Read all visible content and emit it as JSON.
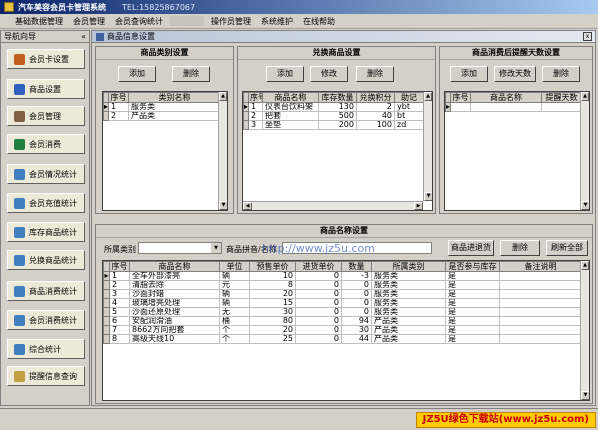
{
  "window": {
    "title": "汽车美容会员卡管理系统",
    "tel": "TEL:15825867067"
  },
  "menu": [
    "基础数据管理",
    "会员管理",
    "会员查询统计",
    "",
    "操作员管理",
    "系统维护",
    "在线帮助"
  ],
  "nav": {
    "title": "导航向导",
    "collapse": "«",
    "items": [
      "会员卡设置",
      "商品设置",
      "会员管理",
      "会员消费",
      "会员情况统计",
      "会员充值统计",
      "库存商品统计",
      "兑换商品统计",
      "商品消费统计",
      "会员消费统计",
      "综合统计",
      "提醒信息查询"
    ]
  },
  "main": {
    "title": "商品信息设置",
    "close": "x"
  },
  "category_panel": {
    "title": "商品类别设置",
    "buttons": {
      "add": "添加",
      "delete": "删除"
    },
    "columns": [
      "序号",
      "类别名称"
    ],
    "rows": [
      [
        "1",
        "服务类"
      ],
      [
        "2",
        "产品类"
      ]
    ]
  },
  "exchange_panel": {
    "title": "兑换商品设置",
    "buttons": {
      "add": "添加",
      "edit": "修改",
      "delete": "删除"
    },
    "columns": [
      "序号",
      "商品名称",
      "库存数量",
      "兑换积分",
      "助记"
    ],
    "rows": [
      [
        "1",
        "仪表台饮料架",
        "130",
        "2",
        "ybt"
      ],
      [
        "2",
        "把套",
        "500",
        "40",
        "bt"
      ],
      [
        "3",
        "坐垫",
        "200",
        "100",
        "zd"
      ]
    ]
  },
  "reminder_panel": {
    "title": "商品消费后提醒天数设置",
    "buttons": {
      "add": "添加",
      "edit": "修改天数",
      "delete": "删除"
    },
    "columns": [
      "序号",
      "商品名称",
      "提醒天数"
    ]
  },
  "product_panel": {
    "title": "商品名称设置",
    "filter_label": "所属类别",
    "name_label": "商品拼音/名称",
    "buttons": {
      "stock": "商品进退货",
      "delete": "删除",
      "refresh": "刷新全部"
    },
    "columns": [
      "序号",
      "商品名称",
      "单位",
      "预售单价",
      "进货单价",
      "数量",
      "所属类别",
      "是否参与库存",
      "备注说明"
    ],
    "rows": [
      [
        "1",
        "全车外部漆亮",
        "辆",
        "10",
        "0",
        "-3",
        "服务类",
        "是",
        ""
      ],
      [
        "2",
        "清脂去除",
        "元",
        "8",
        "0",
        "0",
        "服务类",
        "是",
        ""
      ],
      [
        "3",
        "沙面封蜡",
        "辆",
        "20",
        "0",
        "0",
        "服务类",
        "是",
        ""
      ],
      [
        "4",
        "玻璃增亮处理",
        "辆",
        "15",
        "0",
        "0",
        "服务类",
        "是",
        ""
      ],
      [
        "5",
        "沙面还原处理",
        "无",
        "30",
        "0",
        "0",
        "服务类",
        "是",
        ""
      ],
      [
        "6",
        "安配润滑油",
        "桶",
        "80",
        "0",
        "94",
        "产品类",
        "是",
        ""
      ],
      [
        "7",
        "8662方向把套",
        "个",
        "20",
        "0",
        "30",
        "产品类",
        "是",
        ""
      ],
      [
        "8",
        "高级天线10",
        "个",
        "25",
        "0",
        "44",
        "产品类",
        "是",
        ""
      ]
    ]
  },
  "watermark": "http://www.jz5u.com",
  "badge": "JZ5U绿色下载站(www.jz5u.com)"
}
